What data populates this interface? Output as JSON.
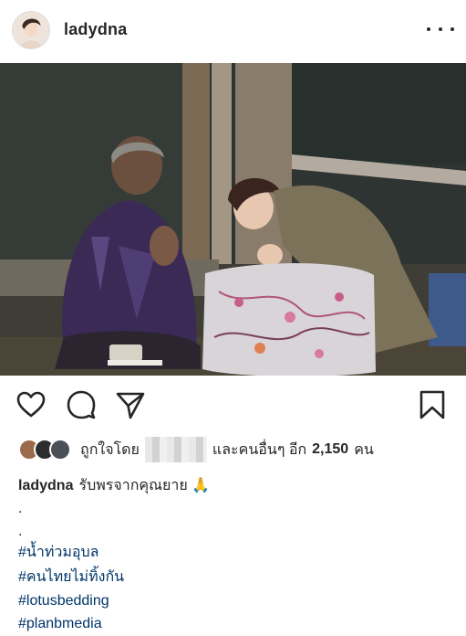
{
  "post": {
    "username": "ladydna",
    "more_label": "more-options"
  },
  "photo": {
    "description_icon": "photo"
  },
  "actions": {
    "like_icon": "heart-icon",
    "comment_icon": "comment-icon",
    "share_icon": "send-icon",
    "save_icon": "bookmark-icon"
  },
  "likes": {
    "prefix": "ถูกใจโดย",
    "suffix": "และคนอื่นๆ อีก",
    "count": "2,150",
    "unit": "คน"
  },
  "caption": {
    "username": "ladydna",
    "text": "รับพรจากคุณยาย",
    "emoji": "🙏",
    "dot1": ".",
    "dot2": "."
  },
  "hashtags": [
    "#น้ำท่วมอุบล",
    "#คนไทยไม่ทิ้งกัน",
    "#lotusbedding",
    "#planbmedia"
  ],
  "colors": {
    "text": "#262626",
    "hashtag": "#003569"
  }
}
